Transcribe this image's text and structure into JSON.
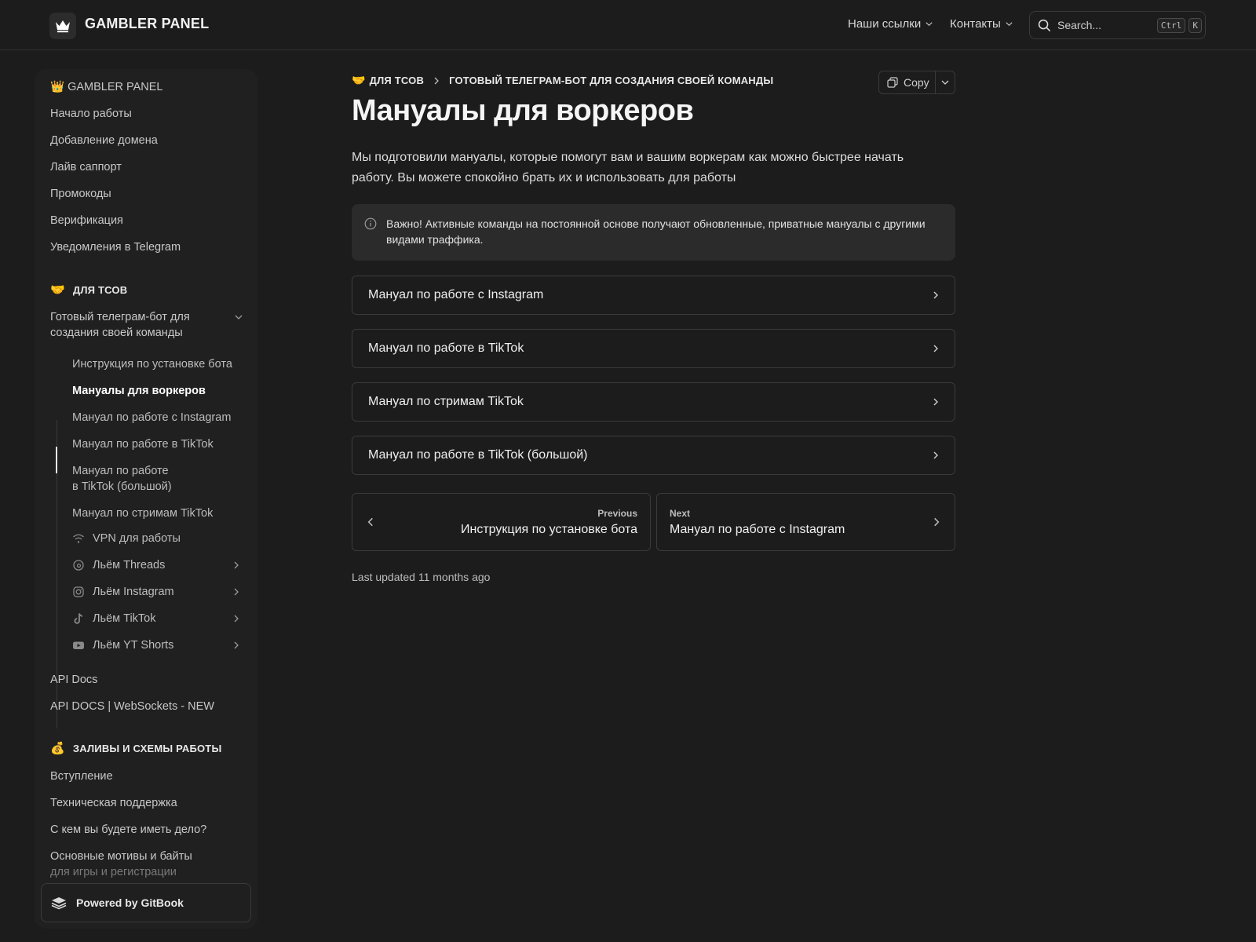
{
  "header": {
    "brand": "GAMBLER PANEL",
    "nav": [
      "Наши ссылки",
      "Контакты"
    ],
    "search_placeholder": "Search...",
    "kbd": [
      "Ctrl",
      "K"
    ]
  },
  "sidebar": {
    "top_title": "👑 GAMBLER PANEL",
    "top_items": [
      "Начало работы",
      "Добавление домена",
      "Лайв саппорт",
      "Промокоды",
      "Верификация",
      "Уведомления в Telegram"
    ],
    "section1": {
      "emoji": "🤝",
      "title": "ДЛЯ ТСОВ",
      "group_line1": "Готовый телеграм-бот для",
      "group_line2": "создания своей команды",
      "sub_items": [
        "Инструкция по установке бота",
        "Мануалы для воркеров",
        "Мануал по работе с Instagram",
        "Мануал по работе в TikTok"
      ],
      "sub_big_line1": "Мануал по работе",
      "sub_big_line2": "в TikTok (большой)",
      "sub_stream": "Мануал по стримам TikTok",
      "icon_items": [
        "VPN для работы",
        "Льём Threads",
        "Льём Instagram",
        "Льём TikTok",
        "Льём YT Shorts"
      ]
    },
    "api_items": [
      "API Docs",
      "API DOCS | WebSockets - NEW"
    ],
    "section2": {
      "emoji": "💰",
      "title": "ЗАЛИВЫ И СХЕМЫ РАБОТЫ",
      "items": [
        "Вступление",
        "Техническая поддержка",
        "С кем вы будете иметь дело?"
      ],
      "last_line1": "Основные мотивы и байты",
      "last_line2": "для игры и регистрации"
    },
    "powered": "Powered by GitBook"
  },
  "main": {
    "breadcrumb": {
      "emoji": "🤝",
      "part1": "ДЛЯ ТСОВ",
      "part2": "ГОТОВЫЙ ТЕЛЕГРАМ-БОТ ДЛЯ СОЗДАНИЯ СВОЕЙ КОМАНДЫ"
    },
    "copy_label": "Copy",
    "title": "Мануалы для воркеров",
    "lead": "Мы подготовили мануалы, которые помогут вам и вашим воркерам как можно быстрее начать работу. Вы можете спокойно брать их и использовать для работы",
    "hint": "Важно! Активные команды на постоянной основе получают обновленные, приватные мануалы с другими видами траффика.",
    "cards": [
      "Мануал по работе с Instagram",
      "Мануал по работе в TikTok",
      "Мануал по стримам TikTok",
      "Мануал по работе в TikTok (большой)"
    ],
    "prev": {
      "label": "Previous",
      "title": "Инструкция по установке бота"
    },
    "next": {
      "label": "Next",
      "title": "Мануал по работе с Instagram"
    },
    "updated": "Last updated 11 months ago"
  }
}
